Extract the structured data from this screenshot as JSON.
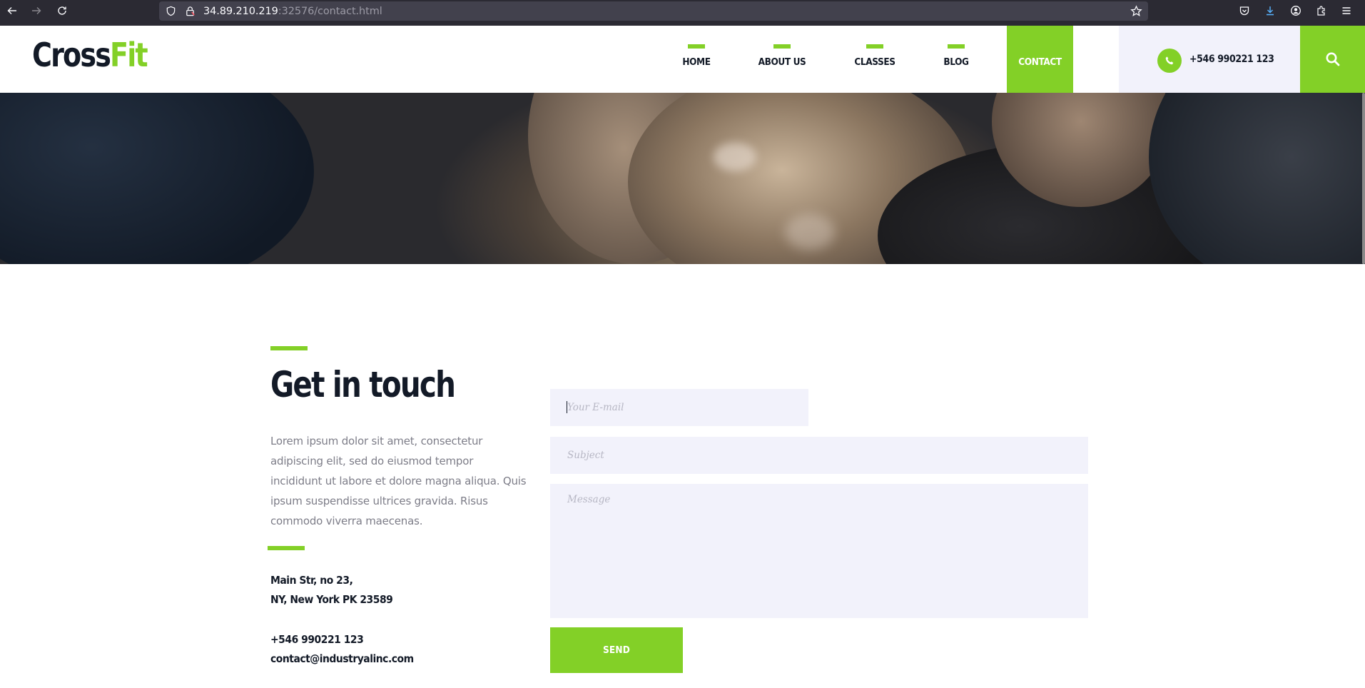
{
  "browser": {
    "url_host": "34.89.210.219",
    "url_path": ":32576/contact.html",
    "icons": [
      "back-arrow-icon",
      "forward-arrow-icon",
      "reload-icon",
      "shield-icon",
      "lock-icon",
      "star-icon",
      "pocket-icon",
      "download-icon",
      "account-icon",
      "extensions-icon",
      "menu-icon"
    ]
  },
  "header": {
    "logo_part1": "Cross",
    "logo_part2": "Fit",
    "nav": [
      {
        "label": "HOME",
        "active": false
      },
      {
        "label": "ABOUT US",
        "active": false
      },
      {
        "label": "CLASSES",
        "active": false
      },
      {
        "label": "BLOG",
        "active": false
      },
      {
        "label": "CONTACT",
        "active": true
      }
    ],
    "phone": "+546 990221 123",
    "accent_color": "#83d027"
  },
  "contact": {
    "heading": "Get in touch",
    "intro": "Lorem ipsum dolor sit amet, consectetur adipiscing elit, sed do eiusmod tempor incididunt ut labore et dolore magna aliqua. Quis ipsum suspendisse ultrices gravida. Risus commodo viverra maecenas.",
    "address_line1": "Main Str, no 23,",
    "address_line2": "NY, New York PK 23589",
    "phone": "+546 990221 123",
    "email": "contact@industryalinc.com",
    "form": {
      "email_placeholder": "Your E-mail",
      "subject_placeholder": "Subject",
      "message_placeholder": "Message",
      "send_label": "SEND"
    }
  }
}
